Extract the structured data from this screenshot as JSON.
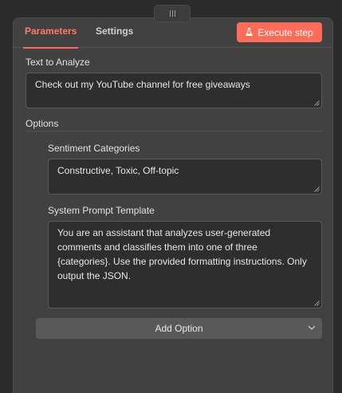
{
  "tabs": {
    "parameters": "Parameters",
    "settings": "Settings"
  },
  "execute_button": {
    "label": "Execute step"
  },
  "text_to_analyze": {
    "label": "Text to Analyze",
    "value": "Check out my YouTube channel for free giveaways"
  },
  "options": {
    "heading": "Options",
    "sentiment_categories": {
      "label": "Sentiment Categories",
      "value": "Constructive, Toxic, Off-topic"
    },
    "system_prompt": {
      "label": "System Prompt Template",
      "value": "You are an assistant that analyzes user-generated comments and classifies them into one of three {categories}. Use the provided formatting instructions. Only output the JSON."
    },
    "add_option_label": "Add Option"
  },
  "colors": {
    "accent": "#ff6d5a",
    "panel": "#414142",
    "field": "#2e2e2e"
  },
  "icons": {
    "execute": "flask-icon",
    "drag": "drag-handle-icon",
    "dropdown": "chevron-down-icon"
  }
}
